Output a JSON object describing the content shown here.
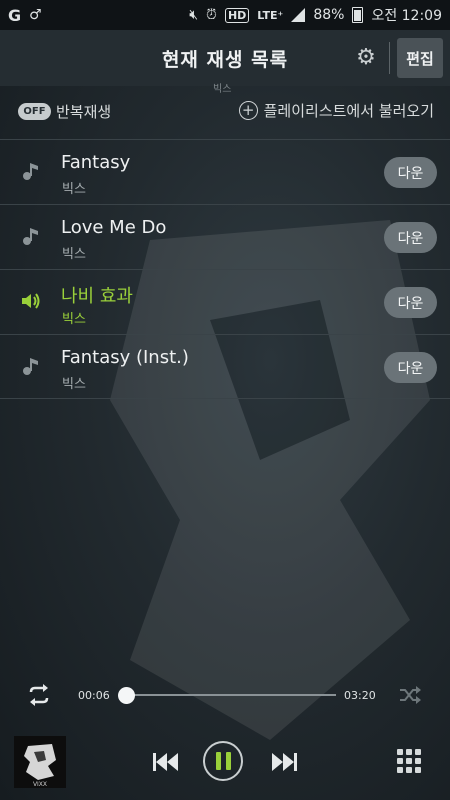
{
  "status_bar": {
    "battery": "88%",
    "time": "오전 12:09",
    "hd": "HD",
    "network": "LTE⁺"
  },
  "header": {
    "title": "현재 재생 목록",
    "edit_label": "편집",
    "ghost_text": "빅스"
  },
  "toolbar": {
    "repeat_state": "OFF",
    "repeat_label": "반복재생",
    "load_label": "플레이리스트에서 불러오기"
  },
  "playlist": [
    {
      "title": "Fantasy",
      "artist": "빅스",
      "download_label": "다운",
      "playing": false
    },
    {
      "title": "Love Me Do",
      "artist": "빅스",
      "download_label": "다운",
      "playing": false
    },
    {
      "title": "나비 효과",
      "artist": "빅스",
      "download_label": "다운",
      "playing": true
    },
    {
      "title": "Fantasy (Inst.)",
      "artist": "빅스",
      "download_label": "다운",
      "playing": false
    }
  ],
  "player": {
    "elapsed": "00:06",
    "duration": "03:20",
    "progress": 0.03,
    "album_label": "VIXX"
  },
  "colors": {
    "accent": "#9ad03a",
    "background": "#222a2f",
    "button": "#6a7378"
  }
}
